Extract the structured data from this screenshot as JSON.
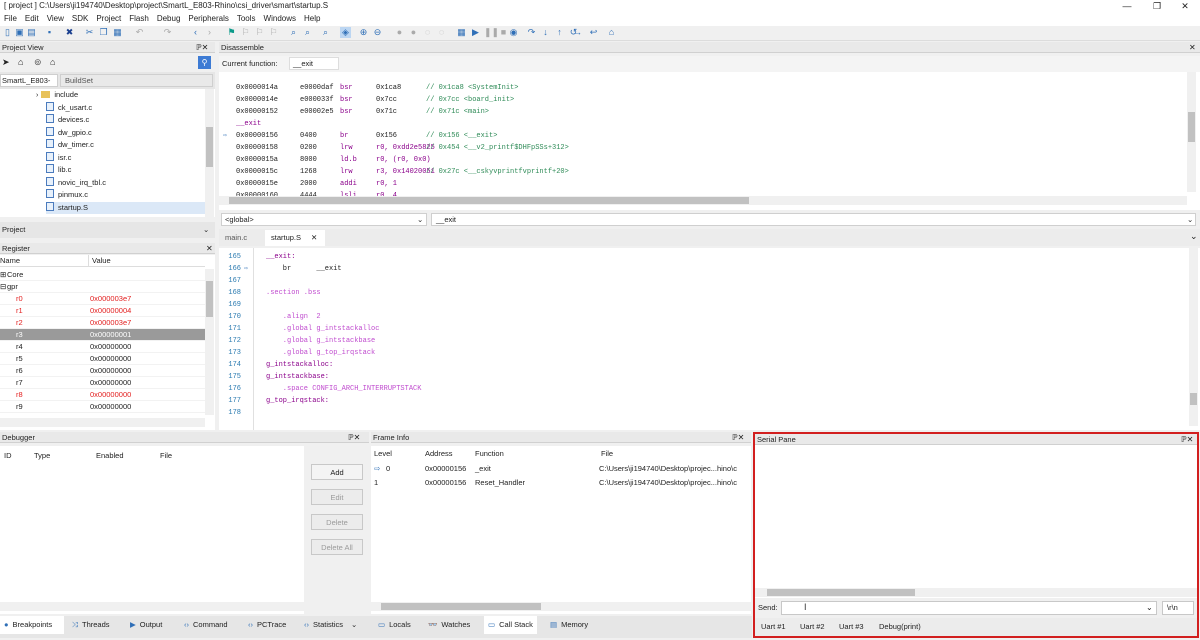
{
  "window": {
    "title": "[ project ] C:\\Users\\ji194740\\Desktop\\project\\SmartL_E803-Rhino\\csi_driver\\smart\\startup.S",
    "min": "—",
    "max": "❐",
    "close": "✕"
  },
  "menu": [
    "File",
    "Edit",
    "View",
    "SDK",
    "Project",
    "Flash",
    "Debug",
    "Peripherals",
    "Tools",
    "Windows",
    "Help"
  ],
  "project_view": {
    "title": "Project View",
    "pin": "ℙ✕",
    "selector_left": "SmartL_E803-",
    "selector_right": "BuildSet",
    "files": [
      {
        "name": "include",
        "type": "folder"
      },
      {
        "name": "ck_usart.c",
        "type": "file"
      },
      {
        "name": "devices.c",
        "type": "file"
      },
      {
        "name": "dw_gpio.c",
        "type": "file"
      },
      {
        "name": "dw_timer.c",
        "type": "file"
      },
      {
        "name": "isr.c",
        "type": "file"
      },
      {
        "name": "lib.c",
        "type": "file"
      },
      {
        "name": "novic_irq_tbl.c",
        "type": "file"
      },
      {
        "name": "pinmux.c",
        "type": "file"
      },
      {
        "name": "startup.S",
        "type": "file"
      }
    ],
    "tab": "Project"
  },
  "register": {
    "title": "Register",
    "col_name": "Name",
    "col_value": "Value",
    "group_core": "Core",
    "group_gpr": "gpr",
    "rows": [
      {
        "name": "r0",
        "value": "0x000003e7",
        "changed": true
      },
      {
        "name": "r1",
        "value": "0x00000004",
        "changed": true
      },
      {
        "name": "r2",
        "value": "0x000003e7",
        "changed": true
      },
      {
        "name": "r3",
        "value": "0x00000001",
        "changed": true
      },
      {
        "name": "r4",
        "value": "0x00000000",
        "changed": false
      },
      {
        "name": "r5",
        "value": "0x00000000",
        "changed": false
      },
      {
        "name": "r6",
        "value": "0x00000000",
        "changed": false
      },
      {
        "name": "r7",
        "value": "0x00000000",
        "changed": false
      },
      {
        "name": "r8",
        "value": "0x00000000",
        "changed": true
      },
      {
        "name": "r9",
        "value": "0x00000000",
        "changed": false
      }
    ]
  },
  "disassemble": {
    "title": "Disassemble",
    "current_function_label": "Current function:",
    "current_function": "__exit",
    "lines": [
      {
        "addr": "0x0000014a",
        "code": "e0000daf",
        "op": "bsr",
        "args": "0x1ca8",
        "comment": "// 0x1ca8 <SystemInit>",
        "arrow": false
      },
      {
        "addr": "0x0000014e",
        "code": "e000033f",
        "op": "bsr",
        "args": "0x7cc",
        "comment": "// 0x7cc <board_init>",
        "arrow": false
      },
      {
        "addr": "0x00000152",
        "code": "e00002e5",
        "op": "bsr",
        "args": "0x71c",
        "comment": "// 0x71c <main>",
        "arrow": false
      },
      {
        "label": "__exit"
      },
      {
        "addr": "0x00000156",
        "code": "0400",
        "op": "br",
        "args": "0x156",
        "comment": "// 0x156 <__exit>",
        "arrow": true
      },
      {
        "addr": "0x00000158",
        "code": "0200",
        "op": "lrw",
        "args": "r0, 0xdd2e5825",
        "comment": "// 0x454 <__v2_printf$DHFpSSs+312>",
        "arrow": false
      },
      {
        "addr": "0x0000015a",
        "code": "8000",
        "op": "ld.b",
        "args": "r0, (r0, 0x0)",
        "comment": "",
        "arrow": false
      },
      {
        "addr": "0x0000015c",
        "code": "1268",
        "op": "lrw",
        "args": "r3, 0x14020051",
        "comment": "// 0x27c <__cskyvprintfvprintf+20>",
        "arrow": false
      },
      {
        "addr": "0x0000015e",
        "code": "2000",
        "op": "addi",
        "args": "r0, 1",
        "comment": "",
        "arrow": false
      },
      {
        "addr": "0x00000160",
        "code": "4444",
        "op": "lsli",
        "args": "r0, 4",
        "comment": "",
        "arrow": false
      }
    ]
  },
  "editor": {
    "scope_left": "<global>",
    "scope_right": "__exit",
    "tabs": [
      {
        "label": "main.c"
      },
      {
        "label": "startup.S",
        "close": "✕"
      }
    ],
    "lines": [
      {
        "n": "165",
        "text": "__exit:",
        "cls": "label"
      },
      {
        "n": "166",
        "text": "    br      __exit",
        "cls": "instr",
        "arrow": true
      },
      {
        "n": "167",
        "text": "",
        "cls": ""
      },
      {
        "n": "168",
        "text": ".section .bss",
        "cls": "dir"
      },
      {
        "n": "169",
        "text": "",
        "cls": ""
      },
      {
        "n": "170",
        "text": "    .align  2",
        "cls": "dir"
      },
      {
        "n": "171",
        "text": "    .global g_intstackalloc",
        "cls": "dir"
      },
      {
        "n": "172",
        "text": "    .global g_intstackbase",
        "cls": "dir"
      },
      {
        "n": "173",
        "text": "    .global g_top_irqstack",
        "cls": "dir"
      },
      {
        "n": "174",
        "text": "g_intstackalloc:",
        "cls": "label"
      },
      {
        "n": "175",
        "text": "g_intstackbase:",
        "cls": "label"
      },
      {
        "n": "176",
        "text": "    .space CONFIG_ARCH_INTERRUPTSTACK",
        "cls": "dir"
      },
      {
        "n": "177",
        "text": "g_top_irqstack:",
        "cls": "label"
      },
      {
        "n": "178",
        "text": "",
        "cls": ""
      }
    ]
  },
  "debugger": {
    "title": "Debugger",
    "cols": [
      "ID",
      "Type",
      "Enabled",
      "File"
    ],
    "buttons": {
      "add": "Add",
      "edit": "Edit",
      "delete": "Delete",
      "delete_all": "Delete All"
    }
  },
  "frame_info": {
    "title": "Frame Info",
    "cols": [
      "Level",
      "Address",
      "Function",
      "File"
    ],
    "rows": [
      {
        "level": "0",
        "address": "0x00000156",
        "function": "_exit",
        "file": "C:\\Users\\ji194740\\Desktop\\projec...hino\\c"
      },
      {
        "level": "1",
        "address": "0x00000156",
        "function": "Reset_Handler",
        "file": "C:\\Users\\ji194740\\Desktop\\projec...hino\\c"
      }
    ]
  },
  "serial": {
    "title": "Serial Pane",
    "send_label": "Send:",
    "send_value": "",
    "newline": "\\r\\n",
    "tabs": [
      "Uart #1",
      "Uart #2",
      "Uart #3",
      "Debug(print)"
    ]
  },
  "bottom_tabs": [
    "Breakpoints",
    "Threads",
    "Output",
    "Command",
    "PCTrace",
    "Statistics",
    "Locals",
    "Watches",
    "Call Stack",
    "Memory"
  ],
  "colors": {
    "accent_red": "#d21f1f",
    "changed_reg": "#e32020",
    "code_comment": "#2e8b57",
    "code_label": "#8b008b"
  }
}
